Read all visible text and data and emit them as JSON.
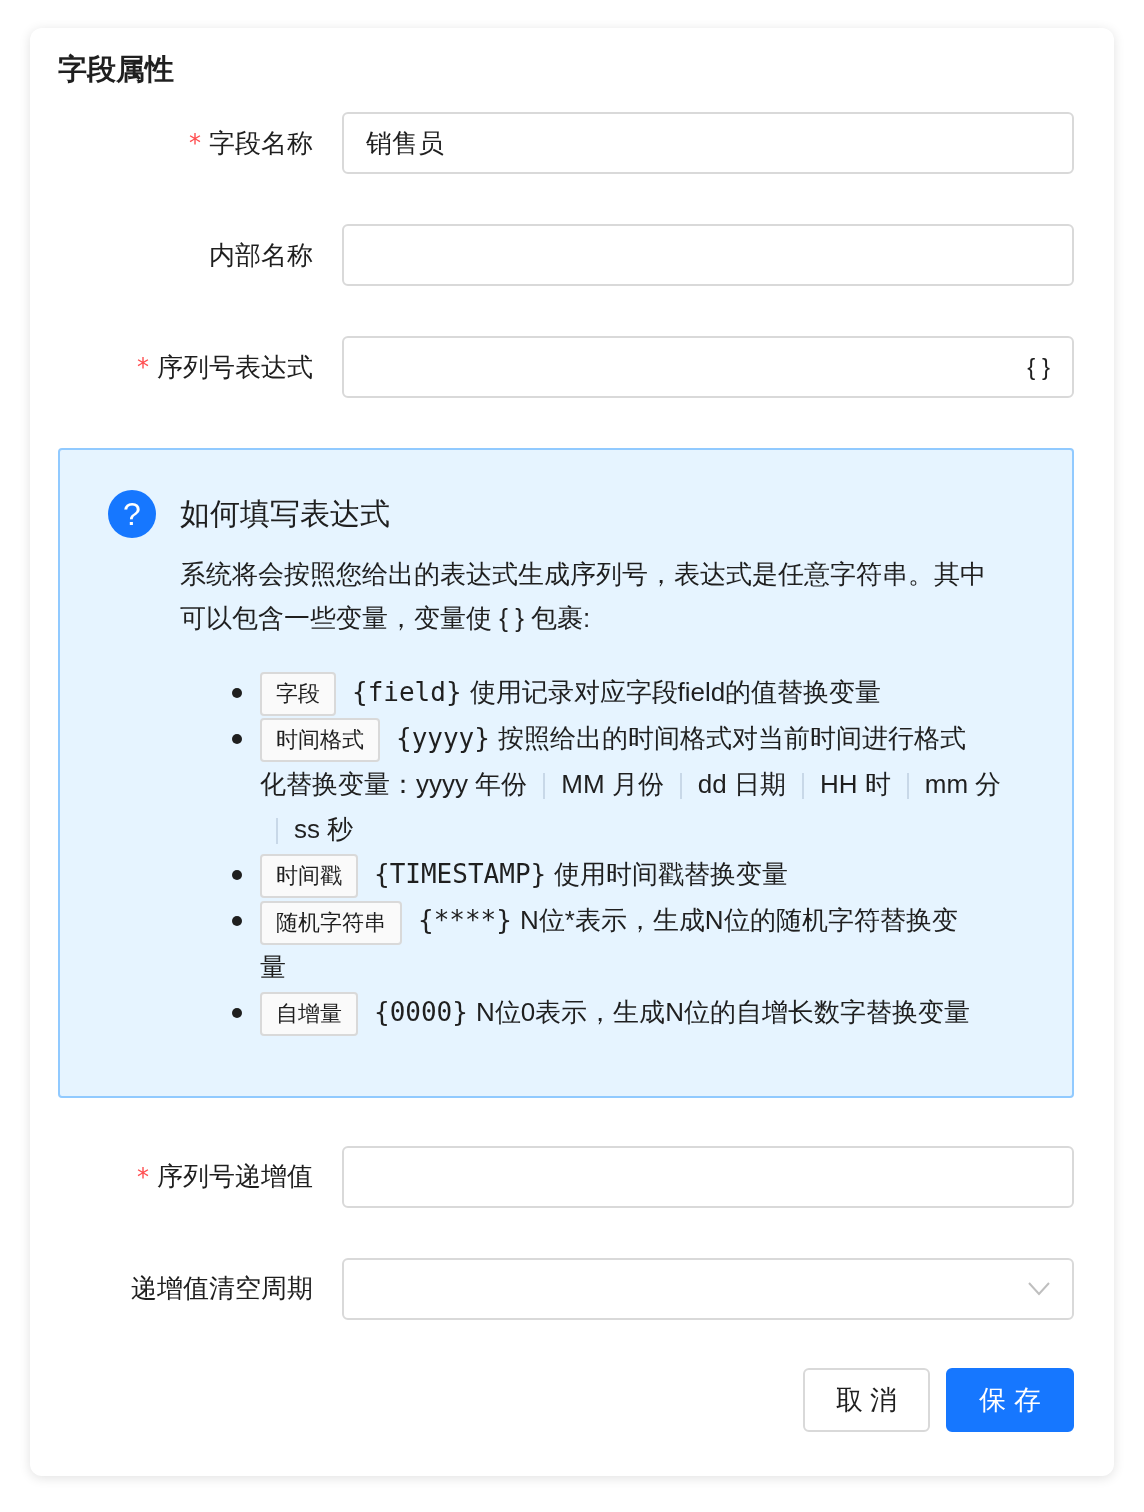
{
  "title": "字段属性",
  "fields": [
    {
      "kind": "input",
      "label": "字段名称",
      "required_mark": "*",
      "value": "销售员"
    },
    {
      "kind": "input",
      "label": "内部名称"
    },
    {
      "kind": "expression",
      "label": "序列号表达式",
      "required_mark": "*",
      "suffix": "{ }"
    }
  ],
  "help": {
    "icon": "?",
    "title": "如何填写表达式",
    "intro": "系统将会按照您给出的表达式生成序列号，表达式是任意字符串。其中可以包含一些变量，变量使 { } 包裹:",
    "items": [
      {
        "tag": "字段",
        "code": "{field}",
        "text": "使用记录对应字段field的值替换变量"
      },
      {
        "tag": "时间格式",
        "code": "{yyyy}",
        "text": "按照给出的时间格式对当前时间进行格式",
        "text_2": "化替换变量：",
        "formats": [
          {
            "token": "yyyy",
            "meaning": "年份"
          },
          {
            "token": "MM",
            "meaning": "月份"
          },
          {
            "token": "dd",
            "meaning": "日期"
          },
          {
            "token": "HH",
            "meaning": "时"
          },
          {
            "token": "mm",
            "meaning": "分"
          },
          {
            "token": "ss",
            "meaning": "秒"
          }
        ]
      },
      {
        "tag": "时间戳",
        "code": "{TIMESTAMP}",
        "text": "使用时间戳替换变量"
      },
      {
        "tag": "随机字符串",
        "code": "{****}",
        "text": "N位*表示，生成N位的随机字符替换变",
        "text_2": "量"
      },
      {
        "tag": "自增量",
        "code": "{0000}",
        "text": "N位0表示，生成N位的自增长数字替换变量"
      }
    ]
  },
  "fields_after": [
    {
      "kind": "input",
      "label": "序列号递增值",
      "required_mark": "*"
    },
    {
      "kind": "select",
      "label": "递增值清空周期"
    }
  ],
  "buttons": [
    {
      "label": "取 消",
      "kind": "default"
    },
    {
      "label": "保 存",
      "kind": "primary"
    }
  ]
}
